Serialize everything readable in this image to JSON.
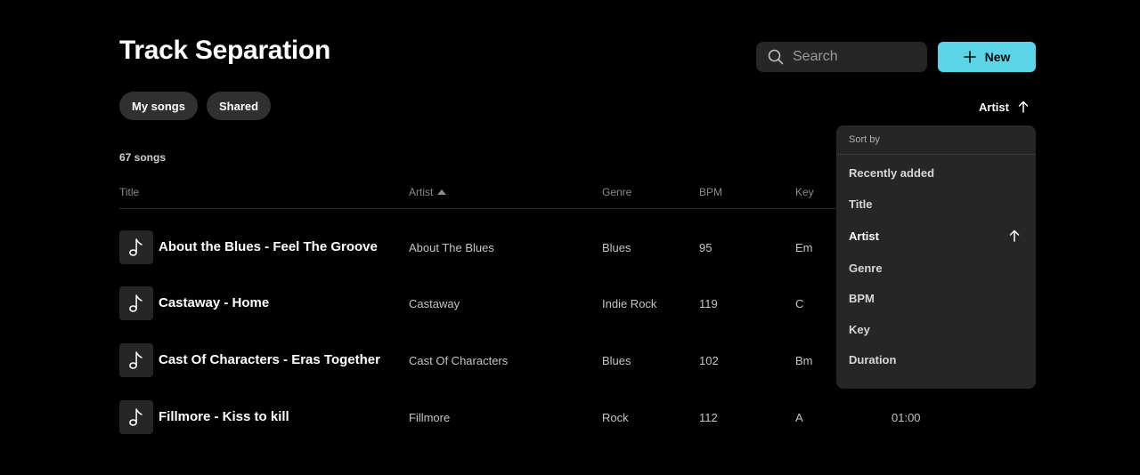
{
  "header": {
    "title": "Track Separation",
    "search_placeholder": "Search",
    "new_label": "New"
  },
  "filters": {
    "my_songs": "My songs",
    "shared": "Shared"
  },
  "sort": {
    "current": "Artist",
    "direction": "ascending"
  },
  "list": {
    "count_label": "67 songs",
    "columns": {
      "title": "Title",
      "artist": "Artist",
      "genre": "Genre",
      "bpm": "BPM",
      "key": "Key"
    },
    "rows": [
      {
        "title": "About the Blues - Feel The Groove",
        "artist": "About The Blues",
        "genre": "Blues",
        "bpm": "95",
        "key": "Em",
        "duration": ""
      },
      {
        "title": "Castaway - Home",
        "artist": "Castaway",
        "genre": "Indie Rock",
        "bpm": "119",
        "key": "C",
        "duration": ""
      },
      {
        "title": "Cast Of Characters - Eras Together",
        "artist": "Cast Of Characters",
        "genre": "Blues",
        "bpm": "102",
        "key": "Bm",
        "duration": ""
      },
      {
        "title": "Fillmore - Kiss to kill",
        "artist": "Fillmore",
        "genre": "Rock",
        "bpm": "112",
        "key": "A",
        "duration": "01:00"
      }
    ]
  },
  "sort_menu": {
    "label": "Sort by",
    "options": [
      {
        "label": "Recently added"
      },
      {
        "label": "Title"
      },
      {
        "label": "Artist",
        "active": true
      },
      {
        "label": "Genre"
      },
      {
        "label": "BPM"
      },
      {
        "label": "Key"
      },
      {
        "label": "Duration"
      }
    ]
  },
  "icons": {
    "search": "search-icon",
    "plus": "plus-icon",
    "arrow_up": "arrow-up-icon",
    "music_note": "music-note-icon"
  },
  "colors": {
    "accent": "#5cd4e8",
    "background": "#000000",
    "surface": "#262626",
    "chip": "#303030"
  }
}
